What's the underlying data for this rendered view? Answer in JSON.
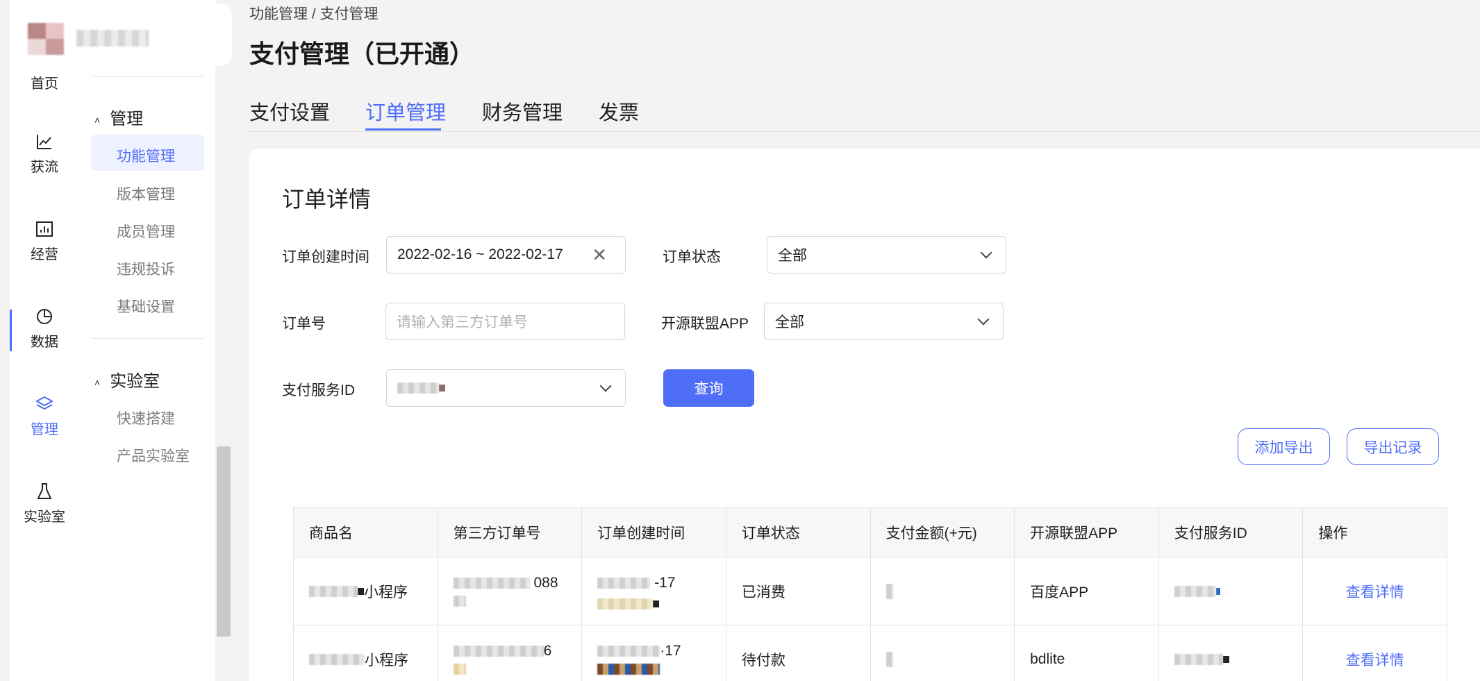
{
  "rail": {
    "items": [
      {
        "label": "首页",
        "icon": "home-icon"
      },
      {
        "label": "获流",
        "icon": "chart-line-icon"
      },
      {
        "label": "经营",
        "icon": "bar-chart-icon"
      },
      {
        "label": "数据",
        "icon": "pie-chart-icon"
      },
      {
        "label": "管理",
        "icon": "layers-icon"
      },
      {
        "label": "实验室",
        "icon": "flask-icon"
      }
    ]
  },
  "submenu": {
    "sections": [
      {
        "title": "管理",
        "items": [
          "功能管理",
          "版本管理",
          "成员管理",
          "违规投诉",
          "基础设置"
        ]
      },
      {
        "title": "实验室",
        "items": [
          "快速搭建",
          "产品实验室"
        ]
      }
    ]
  },
  "breadcrumb": "功能管理 / 支付管理",
  "page_title": "支付管理（已开通）",
  "tabs": [
    "支付设置",
    "订单管理",
    "财务管理",
    "发票"
  ],
  "card": {
    "title": "订单详情",
    "filters": {
      "created_time_label": "订单创建时间",
      "created_time_value": "2022-02-16 ~ 2022-02-17",
      "status_label": "订单状态",
      "status_value": "全部",
      "order_no_label": "订单号",
      "order_no_placeholder": "请输入第三方订单号",
      "app_label": "开源联盟APP",
      "app_value": "全部",
      "service_id_label": "支付服务ID"
    },
    "query_button": "查询",
    "add_export_button": "添加导出",
    "export_records_button": "导出记录"
  },
  "table": {
    "headers": [
      "商品名",
      "第三方订单号",
      "订单创建时间",
      "订单状态",
      "支付金额(+元)",
      "开源联盟APP",
      "支付服务ID",
      "操作"
    ],
    "rows": [
      {
        "product_suffix": "小程序",
        "order_suffix": "088",
        "time_suffix": "-17",
        "status": "已消费",
        "app": "百度APP",
        "action": "查看详情"
      },
      {
        "product_suffix": "小程序",
        "order_suffix": "6",
        "time_suffix": "·17",
        "status": "待付款",
        "app": "bdlite",
        "action": "查看详情"
      }
    ]
  },
  "colors": {
    "accent": "#4f6ef7",
    "background": "#f3f3f3"
  }
}
